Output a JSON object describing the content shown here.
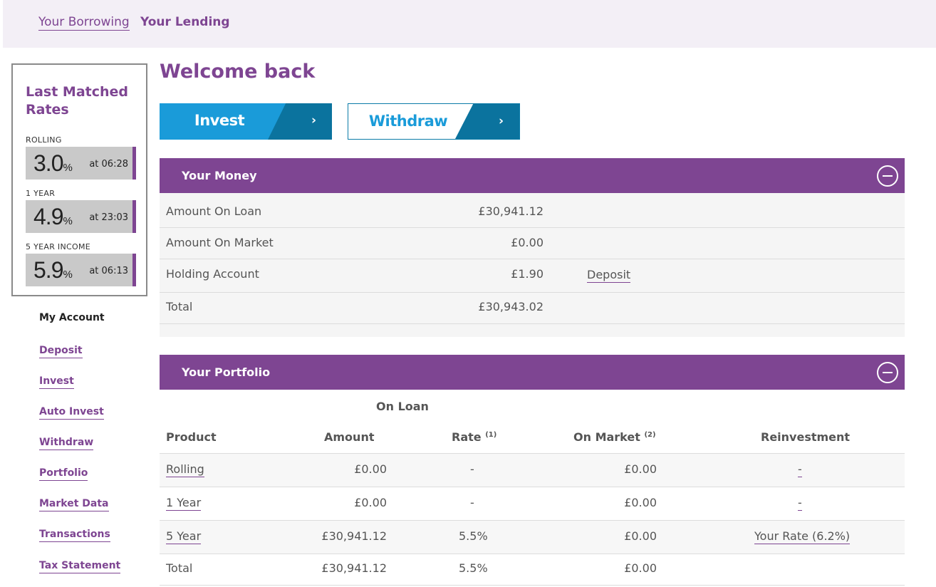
{
  "topnav": {
    "borrowing": "Your Borrowing",
    "lending": "Your Lending"
  },
  "rates": {
    "title": "Last Matched Rates",
    "items": [
      {
        "label": "ROLLING",
        "value": "3.0",
        "pct": "%",
        "time": "at 06:28"
      },
      {
        "label": "1 YEAR",
        "value": "4.9",
        "pct": "%",
        "time": "at 23:03"
      },
      {
        "label": "5 YEAR INCOME",
        "value": "5.9",
        "pct": "%",
        "time": "at 06:13"
      }
    ]
  },
  "sidenav": {
    "heading": "My Account",
    "items": [
      "Deposit",
      "Invest",
      "Auto Invest",
      "Withdraw",
      "Portfolio",
      "Market Data",
      "Transactions",
      "Tax Statement"
    ]
  },
  "main": {
    "welcome": "Welcome back",
    "invest_label": "Invest",
    "withdraw_label": "Withdraw",
    "chevron": "›"
  },
  "money": {
    "title": "Your Money",
    "rows": [
      {
        "label": "Amount On Loan",
        "value": "£30,941.12"
      },
      {
        "label": "Amount On Market",
        "value": "£0.00"
      },
      {
        "label": "Holding Account",
        "value": "£1.90",
        "action": "Deposit"
      },
      {
        "label": "Total",
        "value": "£30,943.02"
      }
    ]
  },
  "portfolio": {
    "title": "Your Portfolio",
    "group_header": "On Loan",
    "headers": {
      "product": "Product",
      "amount": "Amount",
      "rate": "Rate",
      "rate_note": "(1)",
      "market": "On Market",
      "market_note": "(2)",
      "reinvest": "Reinvestment"
    },
    "rows": [
      {
        "product": "Rolling",
        "amount": "£0.00",
        "rate": "-",
        "market": "£0.00",
        "reinvest": "-"
      },
      {
        "product": "1 Year",
        "amount": "£0.00",
        "rate": "-",
        "market": "£0.00",
        "reinvest": "-"
      },
      {
        "product": "5 Year",
        "amount": "£30,941.12",
        "rate": "5.5%",
        "market": "£0.00",
        "reinvest": "Your Rate (6.2%)"
      },
      {
        "product": "Total",
        "amount": "£30,941.12",
        "rate": "5.5%",
        "market": "£0.00",
        "reinvest": ""
      }
    ]
  },
  "colors": {
    "brand": "#7e4592",
    "invest": "#1a9bd9",
    "accent_dark": "#0b739e"
  }
}
